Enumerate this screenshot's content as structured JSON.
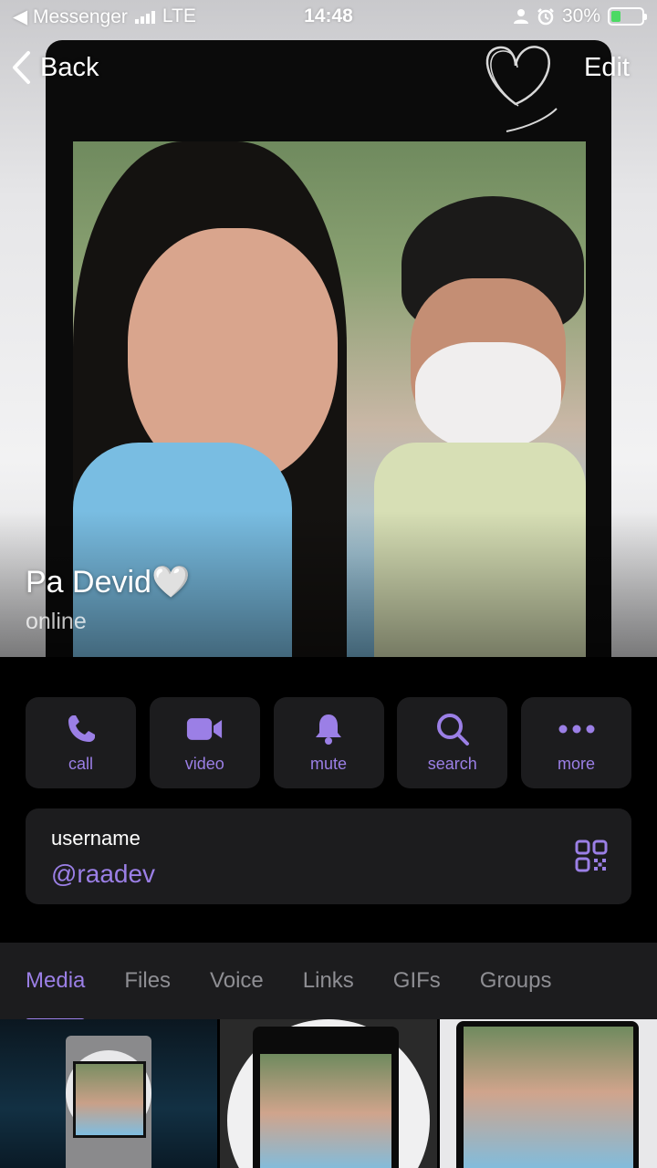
{
  "status_bar": {
    "back_app": "◀ Messenger",
    "network": "LTE",
    "time": "14:48",
    "battery": "30%"
  },
  "nav": {
    "back_label": "Back",
    "edit_label": "Edit"
  },
  "profile": {
    "name": "Pa Devid🤍",
    "status": "online"
  },
  "actions": [
    {
      "label": "call",
      "icon": "phone-icon"
    },
    {
      "label": "video",
      "icon": "video-camera-icon"
    },
    {
      "label": "mute",
      "icon": "bell-icon"
    },
    {
      "label": "search",
      "icon": "search-icon"
    },
    {
      "label": "more",
      "icon": "ellipsis-icon"
    }
  ],
  "username_card": {
    "title": "username",
    "value": "@raadev",
    "icon": "qr-code-icon"
  },
  "tabs": [
    {
      "label": "Media",
      "active": true
    },
    {
      "label": "Files",
      "active": false
    },
    {
      "label": "Voice",
      "active": false
    },
    {
      "label": "Links",
      "active": false
    },
    {
      "label": "GIFs",
      "active": false
    },
    {
      "label": "Groups",
      "active": false
    }
  ],
  "colors": {
    "accent": "#9b7fe6",
    "card_background": "#1c1c1e",
    "inactive_tab": "#8e8e93",
    "battery_fill": "#4cd964"
  }
}
